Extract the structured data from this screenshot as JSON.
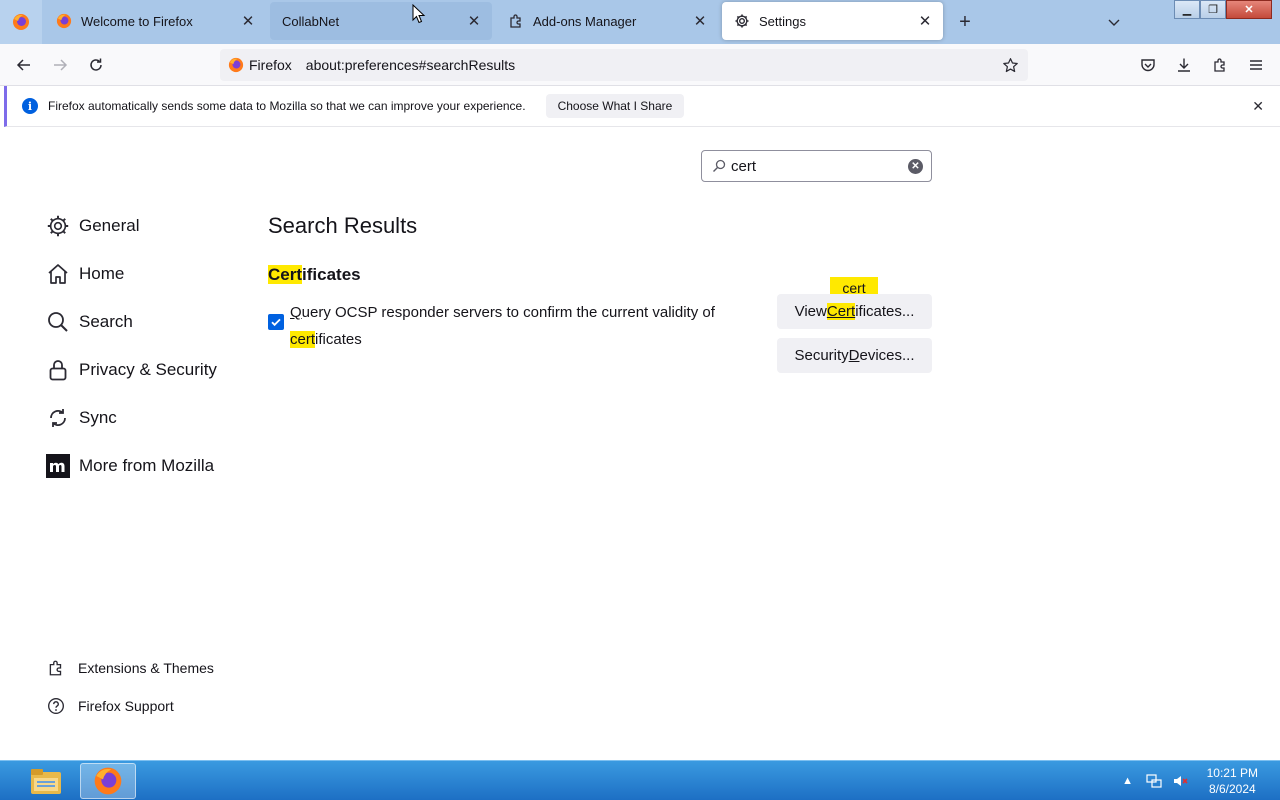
{
  "tabs": [
    {
      "title": "Welcome to Firefox",
      "icon": "firefox-icon",
      "state": "normal"
    },
    {
      "title": "CollabNet",
      "icon": "none",
      "state": "hovered"
    },
    {
      "title": "Add-ons Manager",
      "icon": "puzzle-icon",
      "state": "normal"
    },
    {
      "title": "Settings",
      "icon": "gear-icon",
      "state": "selected"
    }
  ],
  "urlbar": {
    "identity_label": "Firefox",
    "url": "about:preferences#searchResults"
  },
  "notification": {
    "message": "Firefox automatically sends some data to Mozilla so that we can improve your experience.",
    "button_label": "Choose What I Share"
  },
  "search": {
    "value": "cert"
  },
  "categories": [
    {
      "label": "General",
      "icon": "gear-icon"
    },
    {
      "label": "Home",
      "icon": "home-icon"
    },
    {
      "label": "Search",
      "icon": "search-icon"
    },
    {
      "label": "Privacy & Security",
      "icon": "lock-icon"
    },
    {
      "label": "Sync",
      "icon": "sync-icon"
    },
    {
      "label": "More from Mozilla",
      "icon": "mozilla-icon"
    }
  ],
  "footer_links": [
    {
      "label": "Extensions & Themes",
      "icon": "puzzle-icon"
    },
    {
      "label": "Firefox Support",
      "icon": "help-icon"
    }
  ],
  "results": {
    "title": "Search Results",
    "group_title_highlight": "Cert",
    "group_title_rest": "ificates",
    "ocsp_checked": true,
    "ocsp_access_key": "Q",
    "ocsp_part1": "uery OCSP responder servers to confirm the current validity of ",
    "ocsp_highlight": "cert",
    "ocsp_part2": "ificates",
    "tooltip": "cert",
    "view_cert_prefix": "View ",
    "view_cert_highlight": "Cert",
    "view_cert_suffix": "ificates...",
    "security_devices_prefix": "Security ",
    "security_devices_key": "D",
    "security_devices_suffix": "evices..."
  },
  "taskbar": {
    "time": "10:21 PM",
    "date": "8/6/2024"
  },
  "colors": {
    "accent": "#0061e0",
    "highlight": "#ffe900",
    "tabstrip": "#a9c7e8",
    "taskbar": "#1d6fc4"
  }
}
